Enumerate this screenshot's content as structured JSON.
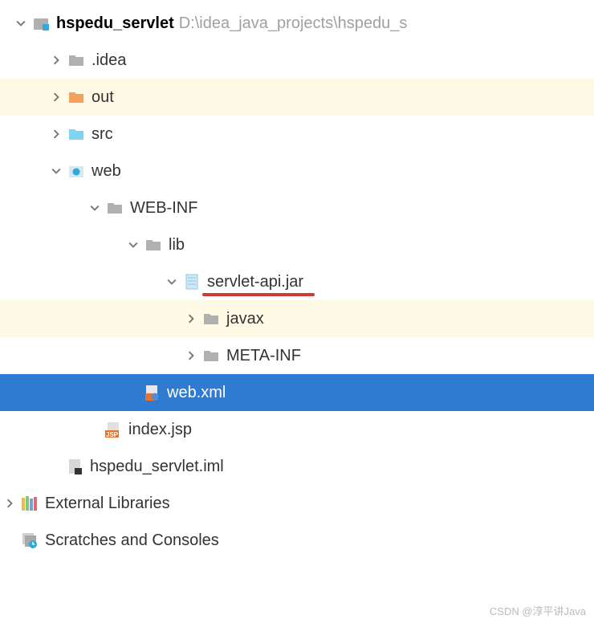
{
  "project": {
    "name": "hspedu_servlet",
    "path": "D:\\idea_java_projects\\hspedu_s"
  },
  "tree": {
    "idea_folder": ".idea",
    "out_folder": "out",
    "src_folder": "src",
    "web_folder": "web",
    "webinf_folder": "WEB-INF",
    "lib_folder": "lib",
    "servlet_jar": "servlet-api.jar",
    "javax_pkg": "javax",
    "metainf_folder": "META-INF",
    "webxml_file": "web.xml",
    "indexjsp_file": "index.jsp",
    "iml_file": "hspedu_servlet.iml"
  },
  "libs": {
    "external": "External Libraries",
    "scratches": "Scratches and Consoles"
  },
  "watermark": "CSDN @淳平讲Java"
}
